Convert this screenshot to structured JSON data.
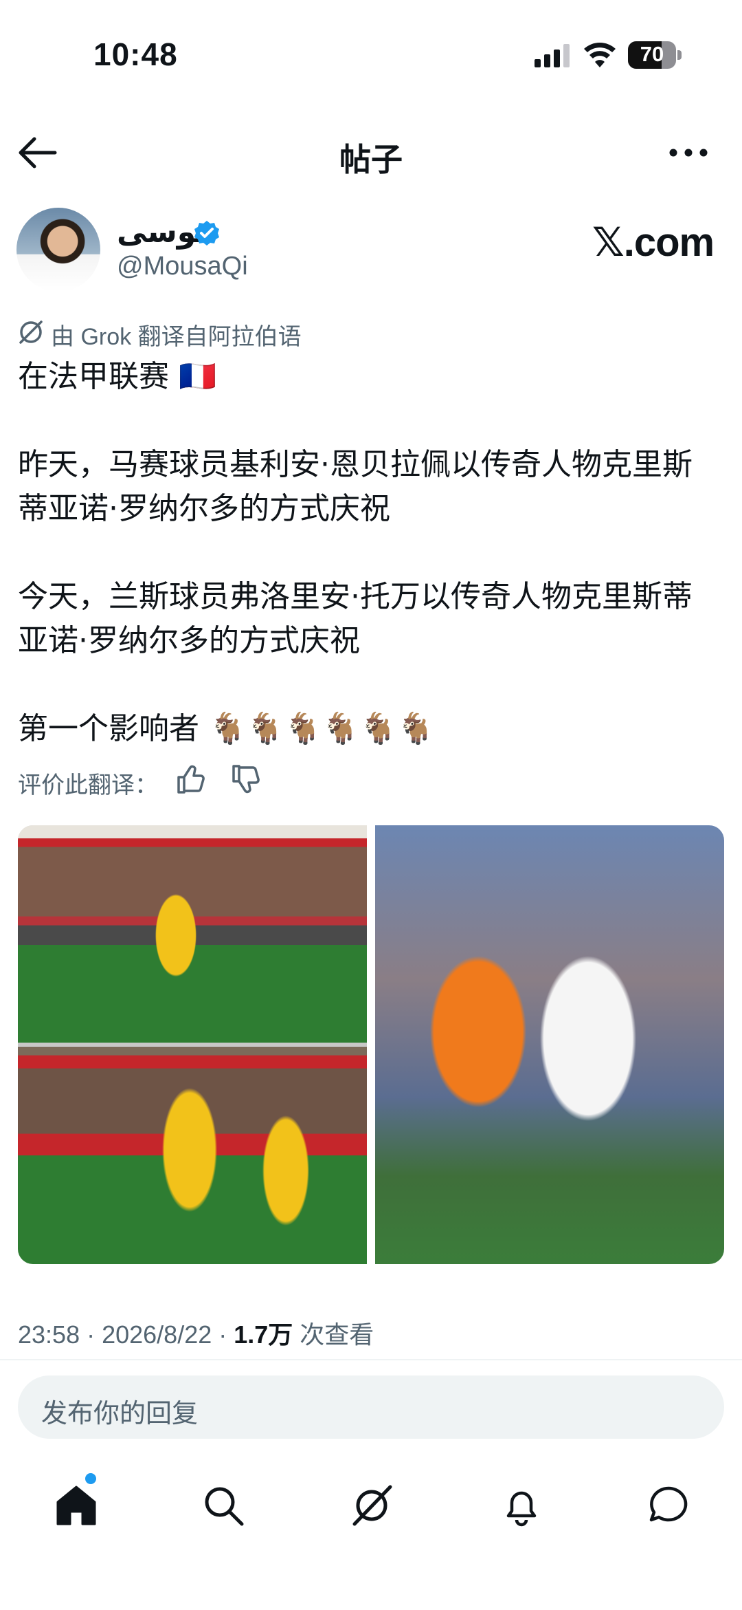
{
  "status_bar": {
    "time": "10:48",
    "battery": "70",
    "battery_level": 0.7
  },
  "nav": {
    "title": "帖子"
  },
  "author": {
    "name": "موسى",
    "handle": "@MousaQi"
  },
  "brand": "𝕏.com",
  "translation": {
    "label": "由 Grok 翻译自阿拉伯语"
  },
  "post": {
    "text": "在法甲联赛 🇫🇷\n\n昨天，马赛球员基利安·恩贝拉佩以传奇人物克里斯蒂亚诺·罗纳尔多的方式庆祝\n\n今天，兰斯球员弗洛里安·托万以传奇人物克里斯蒂亚诺·罗纳尔多的方式庆祝\n\n第一个影响者 🐐🐐🐐🐐🐐🐐"
  },
  "rate": {
    "label": "评价此翻译："
  },
  "meta": {
    "time": "23:58 · 2026/8/22 · ",
    "views": "1.7万",
    "views_label": " 次查看"
  },
  "reply": {
    "placeholder": "发布你的回复"
  },
  "icons": {
    "back": "arrow-left-icon",
    "more": "more-icon",
    "verified": "verified-badge-icon",
    "grok": "grok-icon",
    "like": "thumbs-up-icon",
    "dislike": "thumbs-down-icon",
    "home": "home-icon",
    "search": "search-icon",
    "notifications": "bell-icon",
    "messages": "message-icon"
  },
  "colors": {
    "accent": "#1d9bf0",
    "secondary_text": "#536471",
    "text": "#0f1419"
  }
}
